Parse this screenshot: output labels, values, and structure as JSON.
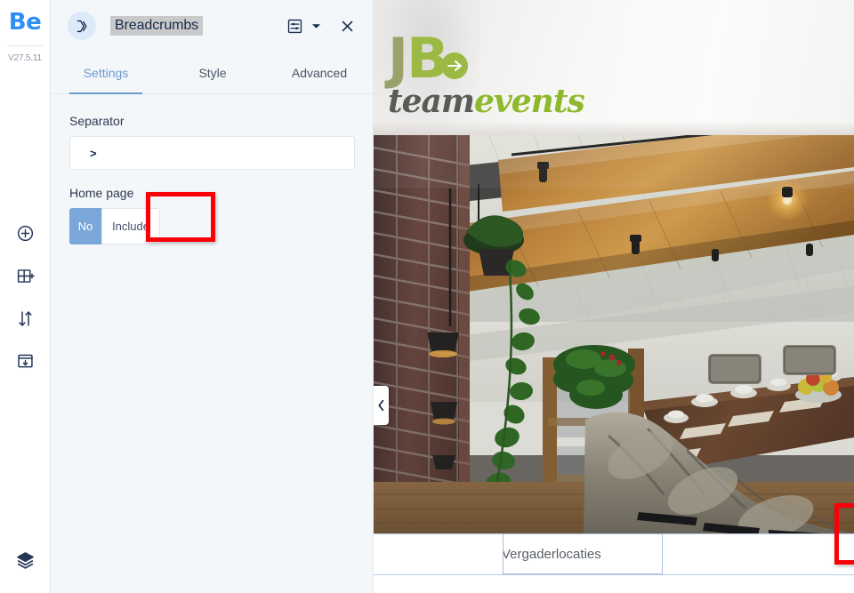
{
  "rail": {
    "logo_text": "Be",
    "version": "V27.5.11",
    "tools": [
      {
        "name": "add-element-icon",
        "label": "Add element"
      },
      {
        "name": "add-layout-icon",
        "label": "Add layout"
      },
      {
        "name": "reorder-icon",
        "label": "Reorder"
      },
      {
        "name": "save-template-icon",
        "label": "Save template"
      }
    ],
    "bottom_tool": {
      "name": "layers-icon",
      "label": "Layers"
    }
  },
  "panel": {
    "widget_icon": "breadcrumbs-icon",
    "widget_title": "Breadcrumbs",
    "header_actions": [
      {
        "name": "widget-settings-icon",
        "label": "Widget settings"
      },
      {
        "name": "chevron-down-icon",
        "label": "More options"
      },
      {
        "name": "close-icon",
        "label": "Close"
      }
    ],
    "tabs": [
      {
        "label": "Settings",
        "active": true
      },
      {
        "label": "Style",
        "active": false
      },
      {
        "label": "Advanced",
        "active": false
      }
    ],
    "fields": {
      "separator": {
        "label": "Separator",
        "value": ">",
        "placeholder": ""
      },
      "home_page": {
        "label": "Home page",
        "options": [
          {
            "label": "No",
            "selected": true
          },
          {
            "label": "Include",
            "selected": false
          }
        ]
      }
    }
  },
  "preview": {
    "brand": {
      "mark_first": "JB",
      "mark_first_a": "J",
      "mark_first_b": "B",
      "word_one": "team",
      "word_two": "events"
    },
    "collapse_icon": "chevron-left-icon",
    "breadcrumb_value": "Vergaderlocaties"
  },
  "annotations": [
    {
      "name": "annotation-include-button",
      "target": "Include"
    },
    {
      "name": "annotation-breadcrumb-field",
      "target": "Vergaderlocaties"
    }
  ],
  "colors": {
    "accent_blue": "#2f8ef4",
    "tab_active": "#6b9bd2",
    "toggle_on": "#7aa7d8",
    "panel_bg": "#f4f7f9",
    "annotation_red": "#fb0007",
    "brand_green": "#9cba43",
    "brand_olive": "#9aa16b",
    "brand_gray": "#5a5a56"
  }
}
